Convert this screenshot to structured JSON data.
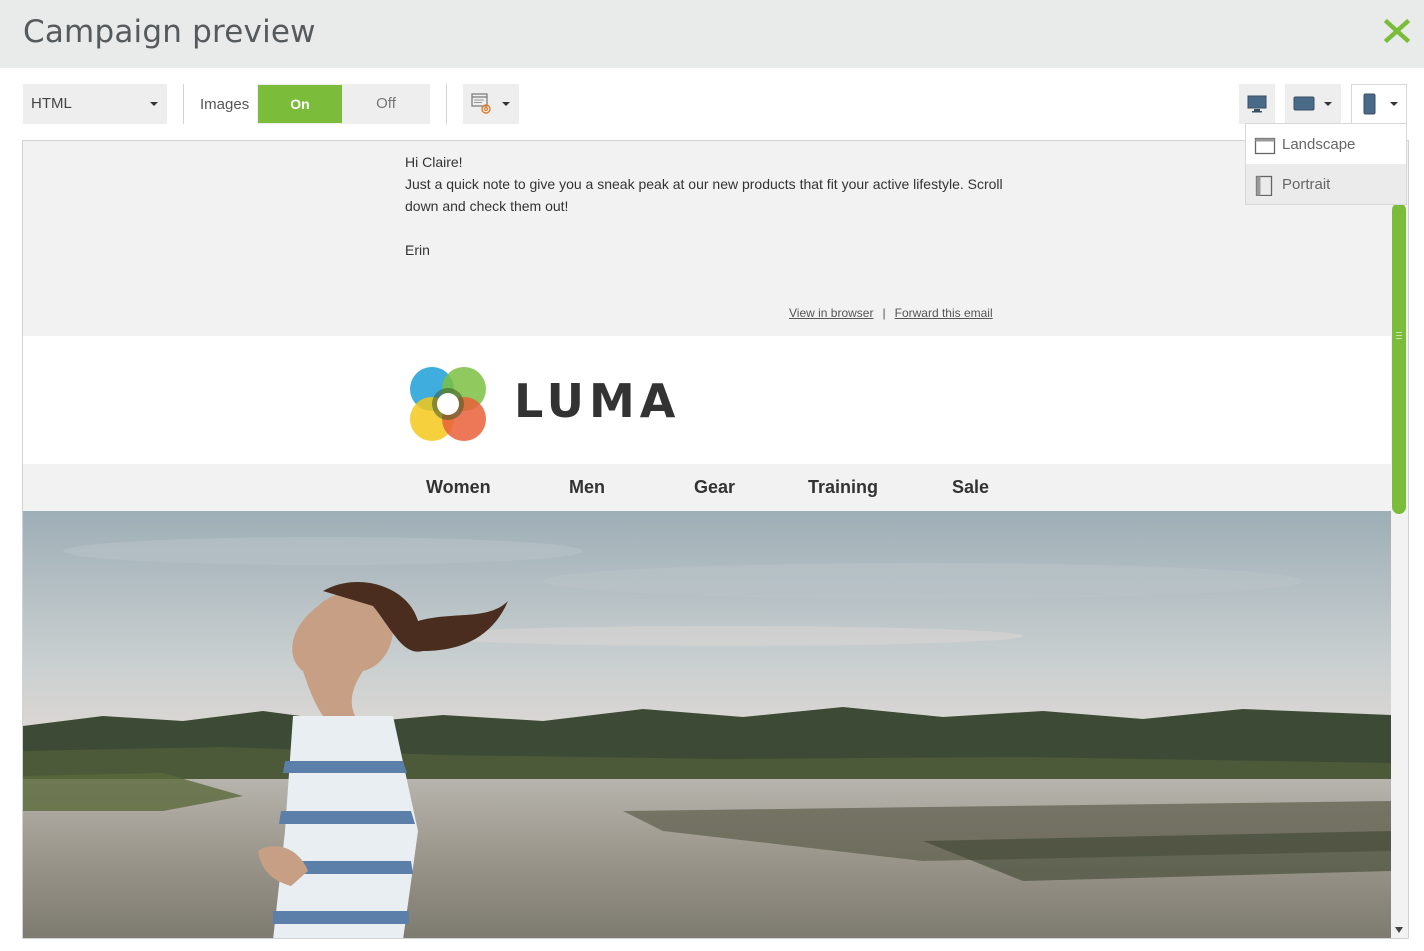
{
  "window": {
    "title": "Campaign preview",
    "close_icon": "close-x-icon",
    "accent": "#7bbd3a"
  },
  "toolbar": {
    "format_select": {
      "value": "HTML"
    },
    "images_label": "Images",
    "images_toggle": {
      "on_label": "On",
      "off_label": "Off",
      "selected": "On"
    },
    "email_client_icon": "email-client-icon",
    "devices": [
      "desktop-icon",
      "tablet-icon",
      "phone-icon"
    ]
  },
  "orientation_menu": {
    "items": [
      {
        "label": "Landscape",
        "icon": "landscape-icon"
      },
      {
        "label": "Portrait",
        "icon": "portrait-icon",
        "highlighted": true
      }
    ]
  },
  "email": {
    "greeting": "Hi Claire!",
    "body": "Just a quick note to give you a sneak peak at our new products that fit your active lifestyle. Scroll down and check them out!",
    "signoff": "Erin",
    "links": {
      "view_in_browser": "View in browser",
      "separator": "|",
      "forward": "Forward this email"
    },
    "brand": "LUMA",
    "nav": [
      "Women",
      "Men",
      "Gear",
      "Training",
      "Sale"
    ],
    "hero_alt": "woman running beside a lake"
  }
}
